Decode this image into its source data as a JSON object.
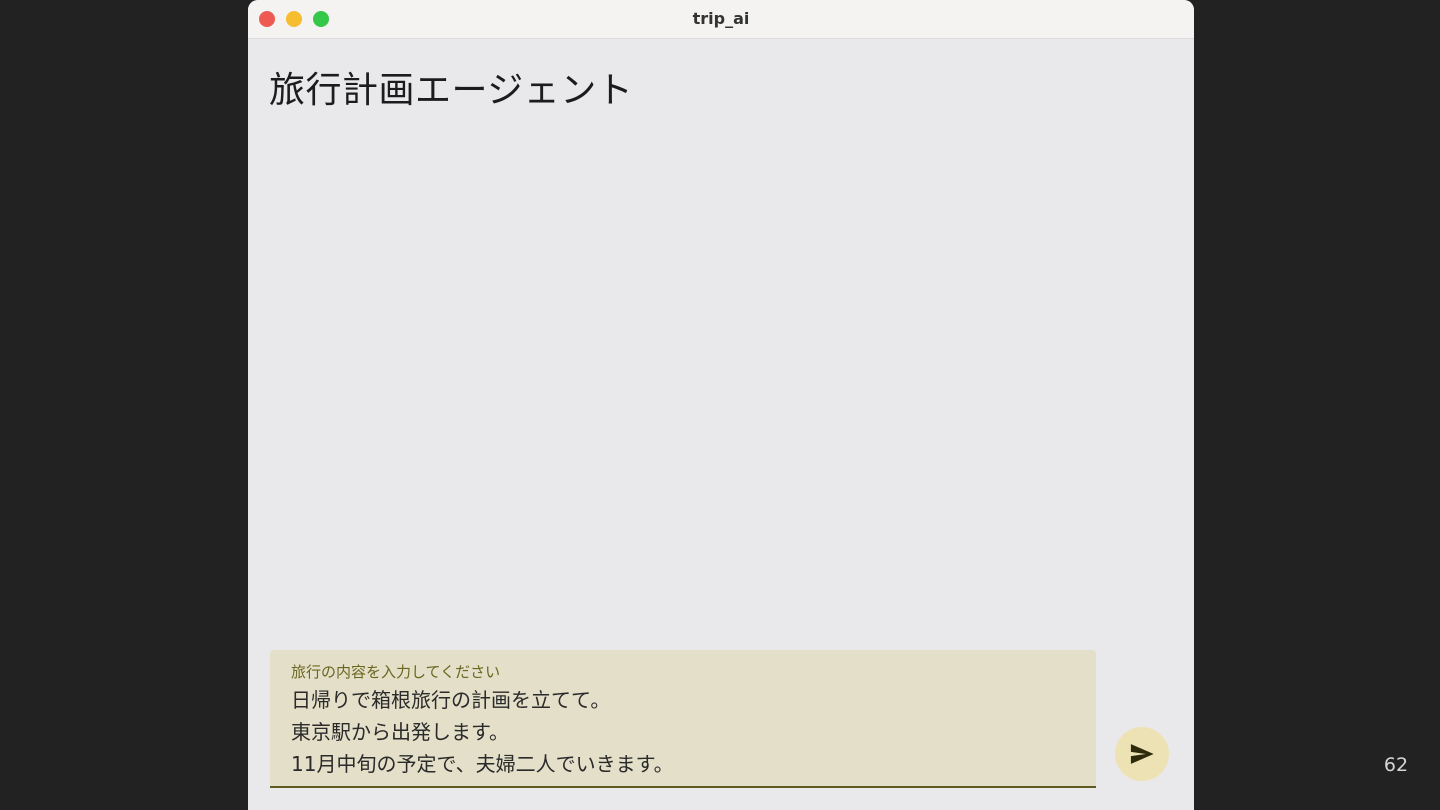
{
  "window": {
    "title": "trip_ai",
    "controls": {
      "close_color": "#ee5a52",
      "minimize_color": "#f5bd2f",
      "zoom_color": "#35c748"
    }
  },
  "page": {
    "title": "旅行計画エージェント"
  },
  "input": {
    "label": "旅行の内容を入力してください",
    "lines": [
      "日帰りで箱根旅行の計画を立てて。",
      "東京駅から出発します。",
      "11月中旬の予定で、夫婦二人でいきます。"
    ]
  },
  "send_button": {
    "icon": "send-icon"
  },
  "slide": {
    "number": "62"
  },
  "colors": {
    "accent": "#5f5a1e",
    "input_background": "#e3dfc8",
    "send_button_background": "#ece2b4"
  }
}
